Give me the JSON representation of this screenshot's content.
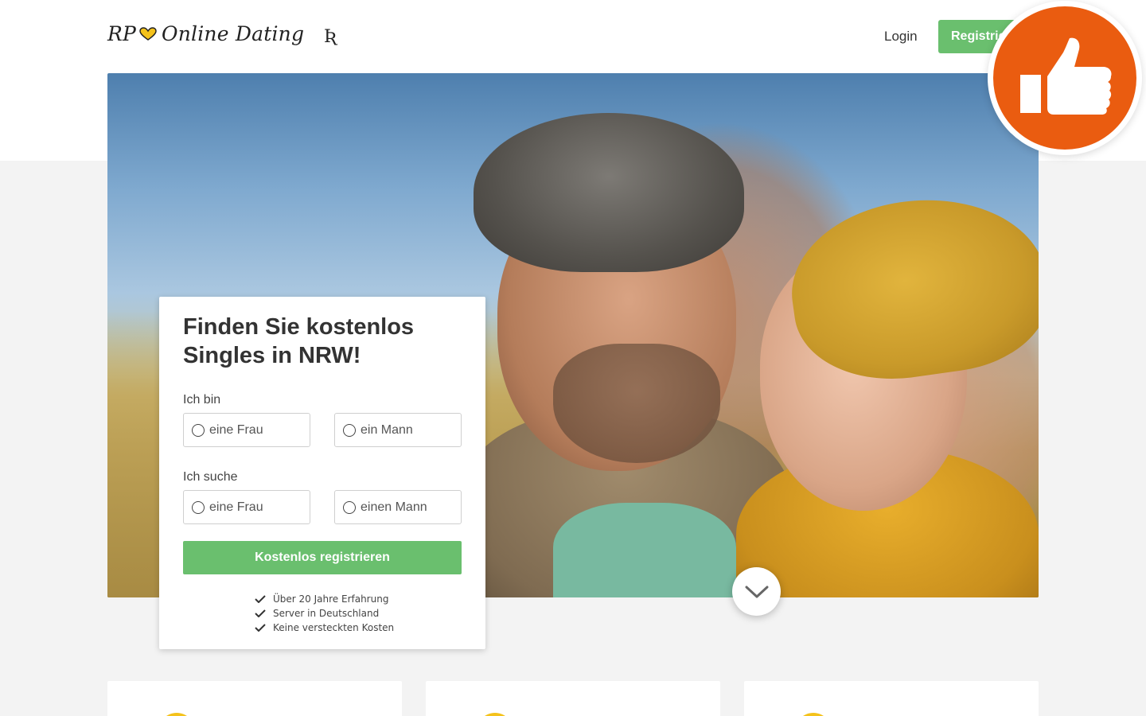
{
  "header": {
    "logo_prefix": "RP",
    "logo_text": "Online Dating",
    "logo_mark": "Ʀ",
    "login_label": "Login",
    "register_label": "Registrieren"
  },
  "form": {
    "title": "Finden Sie kostenlos Singles in NRW!",
    "i_am_label": "Ich bin",
    "i_am_options": [
      "eine Frau",
      "ein Mann"
    ],
    "looking_for_label": "Ich suche",
    "looking_for_options": [
      "eine Frau",
      "einen Mann"
    ],
    "submit_label": "Kostenlos registrieren",
    "benefits": [
      "Über 20 Jahre Erfahrung",
      "Server in Deutschland",
      "Keine versteckten Kosten"
    ]
  },
  "icons": {
    "logo_heart": "heart-icon",
    "scroll": "chevron-down-icon",
    "badge": "thumbs-up-icon",
    "check": "check-icon"
  },
  "colors": {
    "accent_green": "#6abf6e",
    "badge_orange": "#ea5c10",
    "heart_yellow": "#f4c21b"
  }
}
